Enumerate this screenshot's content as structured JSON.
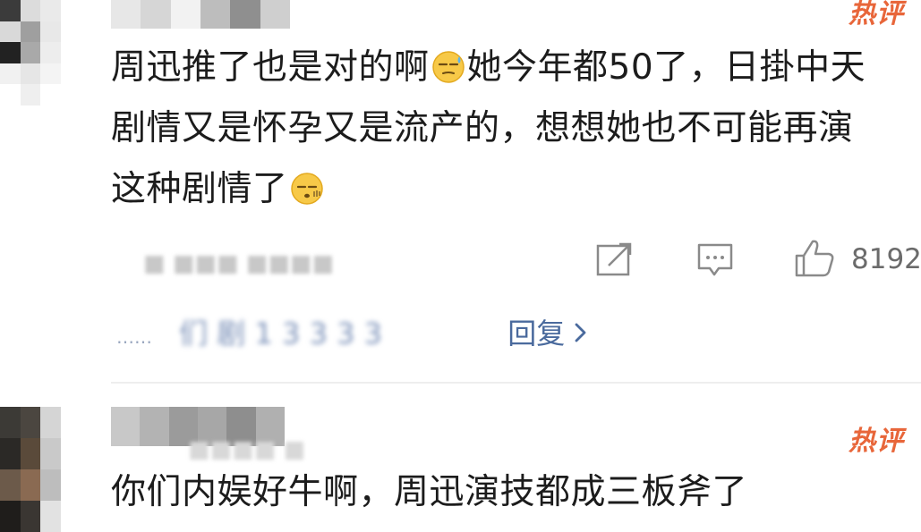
{
  "comments": [
    {
      "badge": "热评",
      "text_lines": [
        "周迅推了也是对的啊",
        "她今年都50了，日掛中天",
        "剧情又是怀孕又是流产的，想想她也不可能再演",
        "这种剧情了"
      ],
      "emojis": [
        "sweat-smile-emoji",
        "sleepy-emoji"
      ],
      "likes": "8192",
      "reply_prefix": "……",
      "reply_blurred": "们 剧 1 3 3 3 3",
      "reply_suffix": "回复"
    },
    {
      "badge": "热评",
      "text_lines": [
        "你们内娱好牛啊，周迅演技都成三板斧了"
      ]
    }
  ],
  "icons": {
    "repost": "repost-icon",
    "comment": "comment-icon",
    "like": "thumbs-up-icon",
    "chevron": "chevron-right-icon"
  },
  "colors": {
    "badge": "#e8663a",
    "link": "#4a6a9d",
    "text": "#1c1c1c",
    "meta": "#6b6b6b"
  }
}
